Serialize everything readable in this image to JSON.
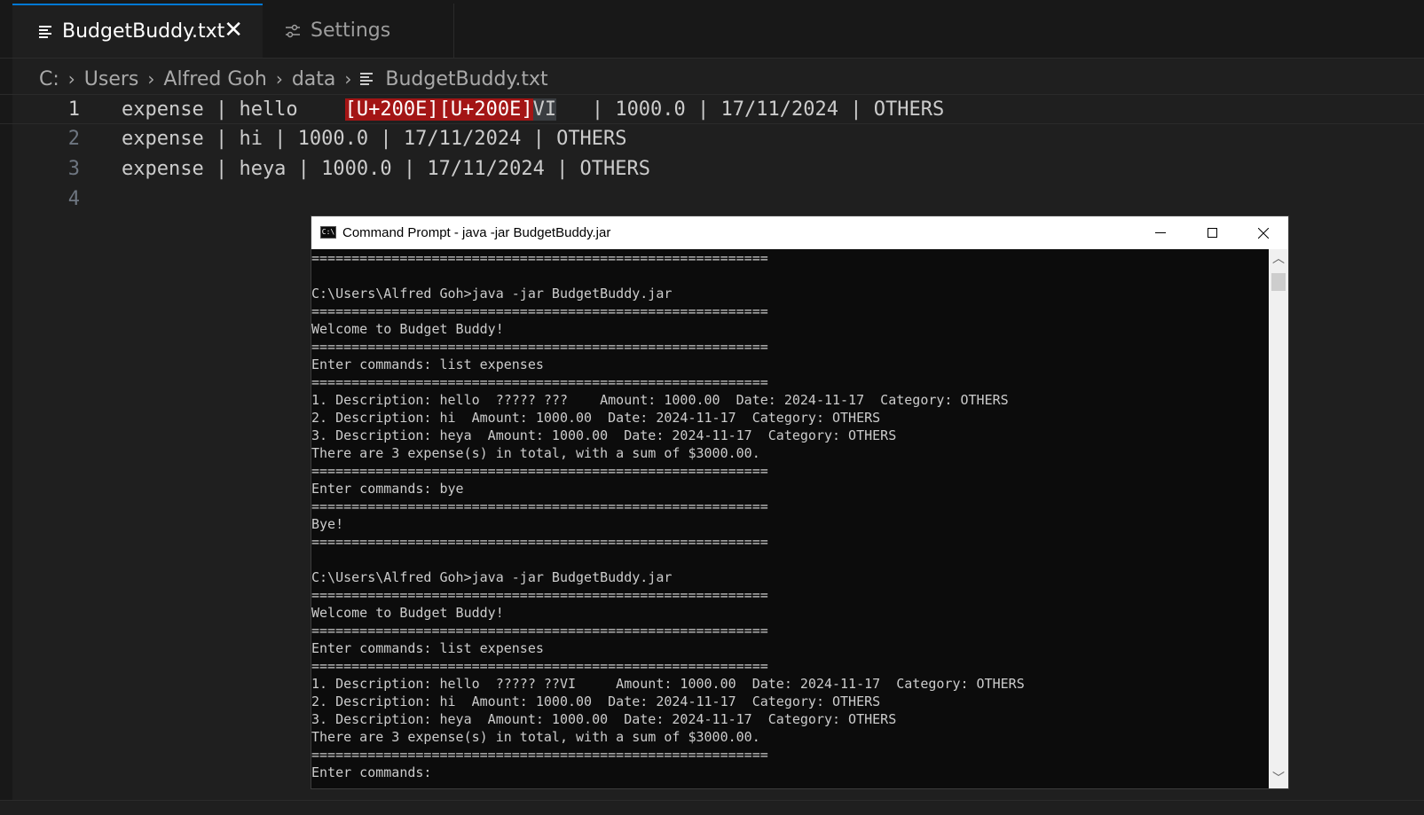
{
  "tabs": [
    {
      "label": "BudgetBuddy.txt",
      "icon": "file-lines-icon",
      "active": true
    },
    {
      "label": "Settings",
      "icon": "settings-sliders-icon",
      "active": false
    }
  ],
  "breadcrumb": [
    "C:",
    "Users",
    "Alfred Goh",
    "data",
    "BudgetBuddy.txt"
  ],
  "editor": {
    "lines": [
      {
        "number": "1",
        "parts": [
          "expense | hello    ",
          "[U+200E][U+200E]",
          "VI",
          "   | 1000.0 | 17/11/2024 | OTHERS"
        ]
      },
      {
        "number": "2",
        "text": "expense | hi | 1000.0 | 17/11/2024 | OTHERS"
      },
      {
        "number": "3",
        "text": "expense | heya | 1000.0 | 17/11/2024 | OTHERS"
      },
      {
        "number": "4",
        "text": ""
      }
    ]
  },
  "cmd_window": {
    "title": "Command Prompt - java  -jar BudgetBuddy.jar",
    "icon_text": "C:\\",
    "output": [
      "=========================================================",
      "",
      "C:\\Users\\Alfred Goh>java -jar BudgetBuddy.jar",
      "=========================================================",
      "Welcome to Budget Buddy!",
      "=========================================================",
      "Enter commands: list expenses",
      "=========================================================",
      "1. Description: hello  ????? ???    Amount: 1000.00  Date: 2024-11-17  Category: OTHERS",
      "2. Description: hi  Amount: 1000.00  Date: 2024-11-17  Category: OTHERS",
      "3. Description: heya  Amount: 1000.00  Date: 2024-11-17  Category: OTHERS",
      "There are 3 expense(s) in total, with a sum of $3000.00.",
      "=========================================================",
      "Enter commands: bye",
      "=========================================================",
      "Bye!",
      "=========================================================",
      "",
      "C:\\Users\\Alfred Goh>java -jar BudgetBuddy.jar",
      "=========================================================",
      "Welcome to Budget Buddy!",
      "=========================================================",
      "Enter commands: list expenses",
      "=========================================================",
      "1. Description: hello  ????? ??VI     Amount: 1000.00  Date: 2024-11-17  Category: OTHERS",
      "2. Description: hi  Amount: 1000.00  Date: 2024-11-17  Category: OTHERS",
      "3. Description: heya  Amount: 1000.00  Date: 2024-11-17  Category: OTHERS",
      "There are 3 expense(s) in total, with a sum of $3000.00.",
      "=========================================================",
      "Enter commands: "
    ]
  },
  "colors": {
    "accent": "#0078d4",
    "editor_bg": "#1f1f1f",
    "invalid_char_bg": "#a31515",
    "console_bg": "#0c0c0c"
  }
}
